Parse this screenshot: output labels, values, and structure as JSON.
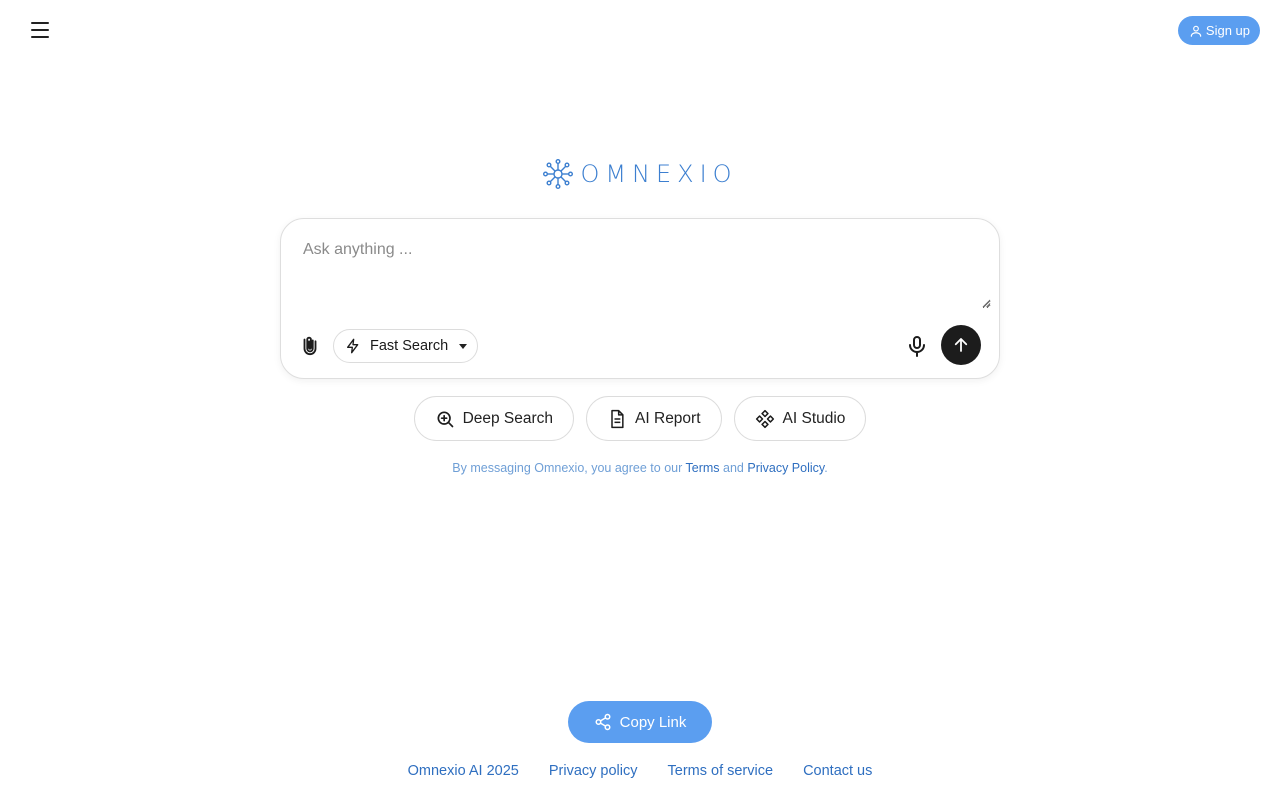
{
  "header": {
    "menu_icon": "hamburger-menu-icon",
    "signup_label": "Sign up"
  },
  "logo": {
    "text": "OMNEXIO",
    "icon": "network-hub-icon",
    "color": "#3c7fd0"
  },
  "prompt": {
    "placeholder": "Ask anything ...",
    "value": "",
    "mode_label": "Fast Search",
    "mode_icon": "lightning-icon"
  },
  "quick_actions": [
    {
      "label": "Deep Search",
      "icon": "zoom-in-icon"
    },
    {
      "label": "AI Report",
      "icon": "document-icon"
    },
    {
      "label": "AI Studio",
      "icon": "diamond-grid-icon"
    }
  ],
  "disclaimer": {
    "prefix": "By messaging Omnexio, you agree to our ",
    "terms": "Terms",
    "and": " and ",
    "privacy": "Privacy Policy",
    "suffix": "."
  },
  "copy_link_label": "Copy Link",
  "footer": {
    "copyright": "Omnexio AI 2025",
    "privacy": "Privacy policy",
    "terms": "Terms of service",
    "contact": "Contact us"
  },
  "colors": {
    "accent": "#5b9ef0",
    "link": "#2f6fc0",
    "send_button": "#1c1c1c"
  }
}
